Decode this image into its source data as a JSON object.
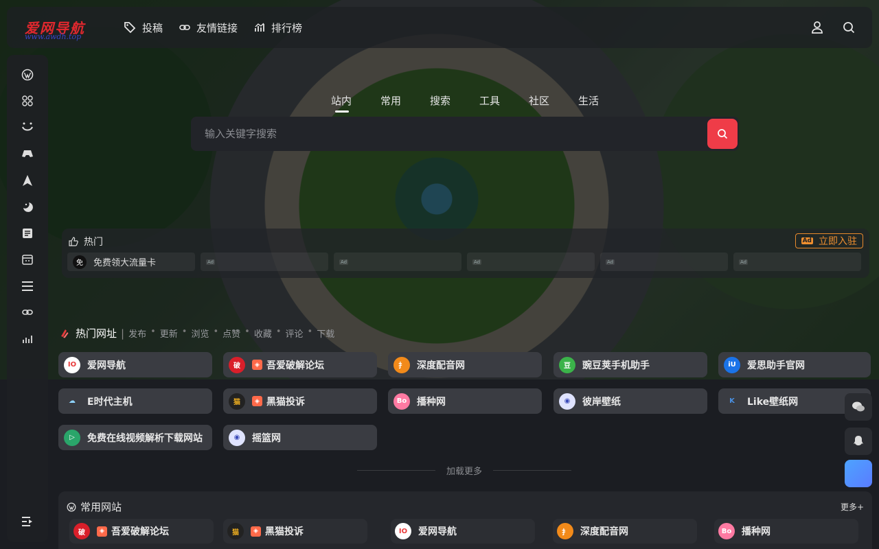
{
  "header": {
    "logo_text": "爱网导航",
    "logo_sub": "www.awdh.top",
    "nav": [
      {
        "label": "投稿",
        "icon": "tag-icon"
      },
      {
        "label": "友情链接",
        "icon": "link-icon"
      },
      {
        "label": "排行榜",
        "icon": "ranking-icon"
      }
    ]
  },
  "search": {
    "tabs": [
      "站内",
      "常用",
      "搜索",
      "工具",
      "社区",
      "生活"
    ],
    "active_tab": "站内",
    "placeholder": "输入关键字搜索"
  },
  "hot": {
    "title": "热门",
    "join_label": "立即入驻",
    "join_ad": "Ad",
    "first_item": {
      "icon_text": "免",
      "label": "免费领大流量卡"
    },
    "ad_tag": "Ad"
  },
  "hot_sites": {
    "title": "热门网址",
    "filters": [
      "发布",
      "更新",
      "浏览",
      "点赞",
      "收藏",
      "评论",
      "下载"
    ],
    "cards": [
      {
        "name": "爱网导航",
        "icon_text": "IO",
        "icon_color": "#ffffff",
        "icon_fg": "#e83a3a",
        "badge": false
      },
      {
        "name": "吾爱破解论坛",
        "icon_text": "破",
        "icon_color": "#d91f2a",
        "icon_fg": "#ffffff",
        "badge": true
      },
      {
        "name": "深度配音网",
        "icon_text": "扌",
        "icon_color": "#f28a1a",
        "icon_fg": "#ffffff",
        "badge": false
      },
      {
        "name": "豌豆荚手机助手",
        "icon_text": "豆",
        "icon_color": "#3bb34a",
        "icon_fg": "#ffffff",
        "badge": false
      },
      {
        "name": "爱思助手官网",
        "icon_text": "iU",
        "icon_color": "#1a73e8",
        "icon_fg": "#ffffff",
        "badge": false
      },
      {
        "name": "E时代主机",
        "icon_text": "☁",
        "icon_color": "#3a3c42",
        "icon_fg": "#8fd4ff",
        "badge": false
      },
      {
        "name": "黑猫投诉",
        "icon_text": "猫",
        "icon_color": "#222222",
        "icon_fg": "#f0b020",
        "badge": true
      },
      {
        "name": "播种网",
        "icon_text": "Bo",
        "icon_color": "#ff7aa2",
        "icon_fg": "#ffffff",
        "badge": false
      },
      {
        "name": "彼岸壁纸",
        "icon_text": "◉",
        "icon_color": "#dfe3ff",
        "icon_fg": "#3a4ab8",
        "badge": false
      },
      {
        "name": "Like壁纸网",
        "icon_text": "K",
        "icon_color": "#3a3c42",
        "icon_fg": "#4a90e2",
        "badge": false
      },
      {
        "name": "免费在线视频解析下载网站",
        "icon_text": "▷",
        "icon_color": "#2aa56a",
        "icon_fg": "#ffffff",
        "badge": false
      },
      {
        "name": "摇篮网",
        "icon_text": "◉",
        "icon_color": "#dfe3ff",
        "icon_fg": "#3a4ab8",
        "badge": false
      }
    ],
    "load_more": "加载更多"
  },
  "common_sites": {
    "title": "常用网站",
    "more": "更多+",
    "items": [
      {
        "name": "吾爱破解论坛",
        "icon_text": "破",
        "icon_color": "#d91f2a",
        "icon_fg": "#ffffff",
        "badge": true
      },
      {
        "name": "黑猫投诉",
        "icon_text": "猫",
        "icon_color": "#222222",
        "icon_fg": "#f0b020",
        "badge": true
      },
      {
        "name": "爱网导航",
        "icon_text": "IO",
        "icon_color": "#ffffff",
        "icon_fg": "#e83a3a",
        "badge": false
      },
      {
        "name": "深度配音网",
        "icon_text": "扌",
        "icon_color": "#f28a1a",
        "icon_fg": "#ffffff",
        "badge": false
      },
      {
        "name": "播种网",
        "icon_text": "Bo",
        "icon_color": "#ff7aa2",
        "icon_fg": "#ffffff",
        "badge": false
      }
    ]
  },
  "colors": {
    "accent": "#ef3c48",
    "join": "#ef8f2f",
    "card_bg": "#3a3c42"
  }
}
